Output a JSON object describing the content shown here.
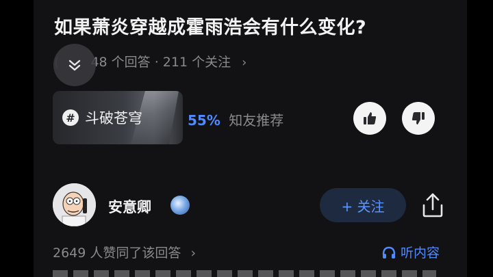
{
  "question": {
    "title": "如果萧炎穿越成霍雨浩会有什么变化?",
    "meta_prefix": "(",
    "meta": "48 个回答 · 211 个关注"
  },
  "topic": {
    "name": "斗破苍穹",
    "recommend_percent": "55%",
    "recommend_label": "知友推荐"
  },
  "author": {
    "name": "安意卿",
    "follow_label": "+ 关注"
  },
  "answer": {
    "likes_text": "2649 人赞同了该回答",
    "listen_label": "听内容"
  },
  "icons": {
    "collapse": "chevron-double-down-icon",
    "upvote": "thumbs-up-icon",
    "downvote": "thumbs-down-icon",
    "share": "share-icon",
    "listen": "headphones-icon"
  },
  "colors": {
    "accent": "#4f8bff",
    "background": "#121214",
    "text_muted": "#8a8a8e"
  }
}
